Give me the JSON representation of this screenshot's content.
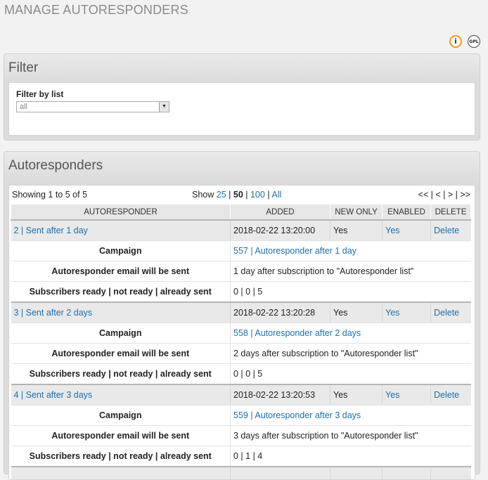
{
  "page_title": "MANAGE AUTORESPONDERS",
  "icons": {
    "info": "info-icon",
    "gpl": "gpl-icon",
    "info_glyph": "i",
    "gpl_glyph": "GPL"
  },
  "filter": {
    "title": "Filter",
    "label": "Filter by list",
    "select_value": "all"
  },
  "autoresponders": {
    "title": "Autoresponders",
    "showing": "Showing 1 to 5 of 5",
    "show_label": "Show",
    "show_options": [
      "25",
      "50",
      "100",
      "All"
    ],
    "pager": [
      "<<",
      "<",
      ">",
      ">>"
    ],
    "columns": [
      "AUTORESPONDER",
      "ADDED",
      "NEW ONLY",
      "ENABLED",
      "DELETE"
    ],
    "detail_labels": {
      "campaign": "Campaign",
      "sent": "Autoresponder email will be sent",
      "subs": "Subscribers ready | not ready | already sent"
    },
    "rows": [
      {
        "name": "2 | Sent after 1 day",
        "added": "2018-02-22 13:20:00",
        "new_only": "Yes",
        "enabled": "Yes",
        "delete": "Delete",
        "campaign": "557 | Autoresponder after 1 day",
        "sent": "1 day after subscription to \"Autoresponder list\"",
        "subs": "0 | 0 | 5"
      },
      {
        "name": "3 | Sent after 2 days",
        "added": "2018-02-22 13:20:28",
        "new_only": "Yes",
        "enabled": "Yes",
        "delete": "Delete",
        "campaign": "558 | Autoresponder after 2 days",
        "sent": "2 days after subscription to \"Autoresponder list\"",
        "subs": "0 | 0 | 5"
      },
      {
        "name": "4 | Sent after 3 days",
        "added": "2018-02-22 13:20:53",
        "new_only": "Yes",
        "enabled": "Yes",
        "delete": "Delete",
        "campaign": "559 | Autoresponder after 3 days",
        "sent": "3 days after subscription to \"Autoresponder list\"",
        "subs": "0 | 1 | 4"
      }
    ]
  }
}
